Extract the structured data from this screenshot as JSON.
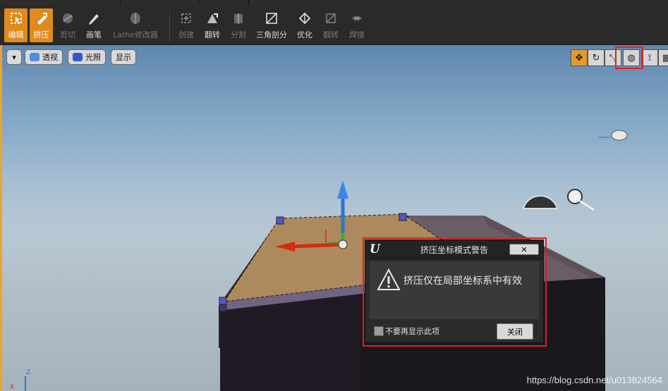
{
  "toolbar": {
    "tools": [
      {
        "label": "编辑",
        "icon": "edit-icon"
      },
      {
        "label": "挤压",
        "icon": "extrude-icon"
      },
      {
        "label": "剪切",
        "icon": "cut-icon"
      },
      {
        "label": "画笔",
        "icon": "pen-icon"
      },
      {
        "label": "Lathe修改器",
        "icon": "lathe-icon"
      },
      {
        "label": "创建",
        "icon": "create-icon"
      },
      {
        "label": "翻转",
        "icon": "flip-icon"
      },
      {
        "label": "分割",
        "icon": "split-icon"
      },
      {
        "label": "三角剖分",
        "icon": "triangulate-icon"
      },
      {
        "label": "优化",
        "icon": "optimize-icon"
      },
      {
        "label": "翻转",
        "icon": "flip-disabled-icon"
      },
      {
        "label": "焊接",
        "icon": "weld-icon"
      }
    ],
    "active_color": "#e08a1e"
  },
  "viewport": {
    "options_menu": "▾",
    "perspective_label": "透视",
    "lit_label": "光照",
    "show_label": "显示",
    "right_icons": [
      "translate-icon",
      "rotate-icon",
      "scale-icon",
      "world-local-icon",
      "surface-snap-icon",
      "grid-snap-icon"
    ],
    "axis_label_z": "Z",
    "axis_label_x": "X"
  },
  "dialog": {
    "title": "挤压坐标模式警告",
    "message": "挤压仅在局部坐标系中有效",
    "checkbox_label": "不要再显示此项",
    "close_button": "关闭",
    "close_x": "✕"
  },
  "watermark": "https://blog.csdn.net/u013824564",
  "colors": {
    "highlight_box": "#e02020",
    "accent": "#e59a2a"
  }
}
